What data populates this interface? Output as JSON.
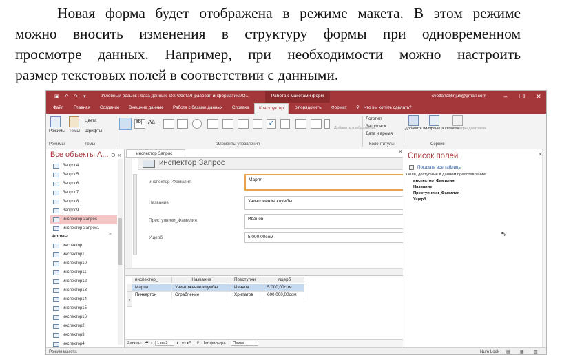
{
  "paragraph": {
    "lines": [
      "Новая форма будет отображена в режиме макета. В этом режиме",
      "можно вносить изменения в структуру формы при одновременном",
      "просмотре данных. Например, при необходимости можно настроить",
      "размер текстовых полей в соответствии с данными."
    ]
  },
  "titlebar": {
    "title": "Угловный розыск : база данных- D:\\Работа\\Правовая информатика\\О...",
    "context_tab": "Работа с макетами форм",
    "user": "svetlanablinjuk@gmail.com",
    "minimize": "–",
    "restore": "❐",
    "close": "✕"
  },
  "tabs": [
    "Файл",
    "Главная",
    "Создание",
    "Внешние данные",
    "Работа с базами данных",
    "Справка",
    "Конструктор",
    "Упорядочить",
    "Формат"
  ],
  "active_tab": "Конструктор",
  "search_tell": "Что вы хотите сделать?",
  "ribbon": {
    "themes": [
      "Режимы",
      "Темы",
      "Цвета",
      "Шрифты"
    ],
    "add_fields": "Добавить имеющиеся поля",
    "add_fields_short": "Добавить поля",
    "add_fields_dim": "Добавить изображение",
    "header_items": [
      "Логотип",
      "Заголовок",
      "Дата и время"
    ],
    "page_props": "Страница свойств",
    "diagram_params": "Параметры диаграмм",
    "groups": [
      "Режимы",
      "Темы",
      "Элементы управления",
      "Колонтитулы",
      "Сервис"
    ],
    "colors_label": "Цвета",
    "fonts_label": "Шрифты",
    "abl_label": "ab|",
    "aa_label": "Aa"
  },
  "nav": {
    "heading": "Все объекты А...",
    "queries": [
      "Запрос4",
      "Запрос5",
      "Запрос6",
      "Запрос7",
      "Запрос8",
      "Запрос9",
      "инспектор Запрос",
      "инспектор Запрос1"
    ],
    "active_query": "инспектор Запрос",
    "forms_heading": "Формы",
    "forms": [
      "инспектор",
      "инспектор1",
      "инспектор10",
      "инспектор11",
      "инспектор12",
      "инспектор13",
      "инспектор14",
      "инспектор15",
      "инспектор16",
      "инспектор2",
      "инспектор3",
      "инспектор4"
    ]
  },
  "document": {
    "tab": "инспектор Запрос",
    "form_title": "инспектор Запрос",
    "fields": [
      {
        "label": "инспектор_Фамилия",
        "value": "Марпл"
      },
      {
        "label": "Название",
        "value": "Уничтожение клумбы"
      },
      {
        "label": "Преступники_Фамилия",
        "value": "Иванов"
      },
      {
        "label": "Ущерб",
        "value": "5 000,00сом"
      }
    ]
  },
  "datasheet": {
    "columns": [
      "инспектор_",
      "Название",
      "Преступни",
      "Ущерб"
    ],
    "rows": [
      [
        "Марпл",
        "Уничтожение клумбы",
        "Иванов",
        "5 000,00сом"
      ],
      [
        "Пинкертон",
        "Ограбление",
        "Хрипатов",
        "600 000,00сом"
      ]
    ],
    "new_row_marker": "*"
  },
  "record_nav": {
    "label": "Запись:",
    "position": "1 из 2",
    "filter": "Нет фильтра",
    "search": "Поиск"
  },
  "field_list": {
    "title": "Список полей",
    "show_all": "Показать все таблицы",
    "caption": "Поля, доступные в данном представлении:",
    "fields": [
      "инспектор_Фамилия",
      "Название",
      "Преступники_Фамилия",
      "Ущерб"
    ]
  },
  "statusbar": {
    "mode": "Режим макета",
    "numlock": "Num Lock"
  }
}
